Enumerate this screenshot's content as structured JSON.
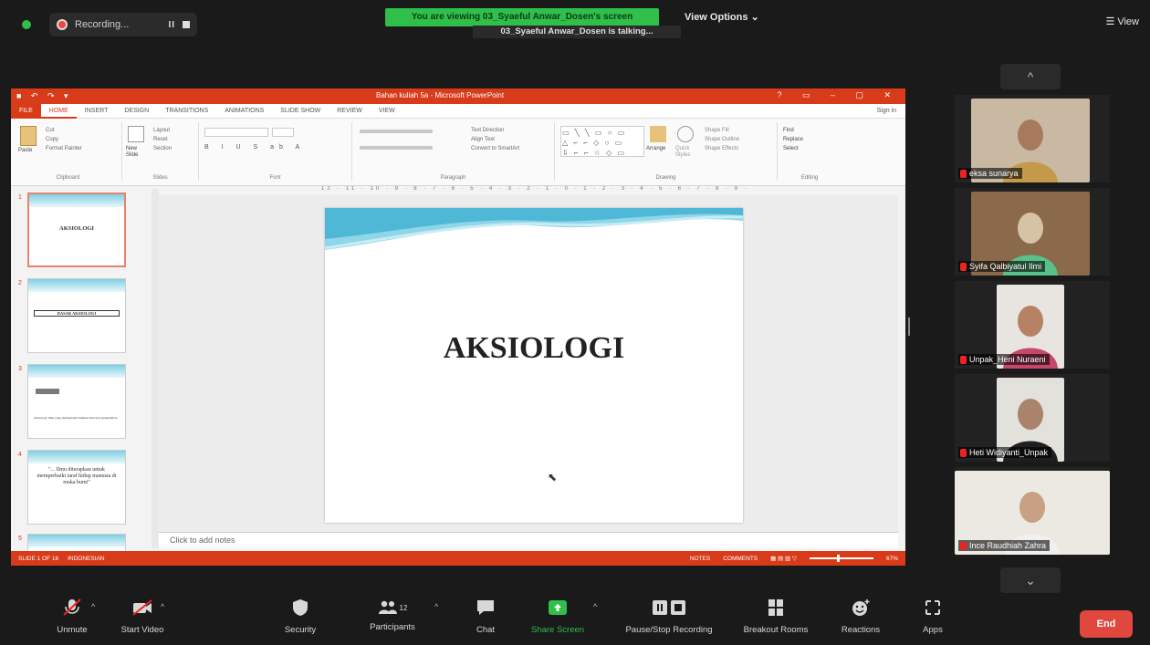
{
  "top_bar": {
    "recording_label": "Recording...",
    "viewing_banner": "You are viewing 03_Syaeful Anwar_Dosen's screen",
    "talking_label": "03_Syaeful Anwar_Dosen is talking...",
    "view_options_label": "View Options ⌄",
    "view_label": "☰ View"
  },
  "ppt": {
    "window_title": "Bahan kuliah 5a - Microsoft PowerPoint",
    "tabs": [
      "FILE",
      "HOME",
      "INSERT",
      "DESIGN",
      "TRANSITIONS",
      "ANIMATIONS",
      "SLIDE SHOW",
      "REVIEW",
      "VIEW"
    ],
    "sign_in": "Sign in",
    "ribbon_groups": [
      "Clipboard",
      "Slides",
      "Font",
      "Paragraph",
      "Drawing",
      "Editing"
    ],
    "ribbon_labels": {
      "paste": "Paste",
      "cut": "Cut",
      "copy": "Copy",
      "format_painter": "Format Painter",
      "new_slide": "New Slide",
      "layout": "Layout",
      "reset": "Reset",
      "section": "Section",
      "arrange": "Arrange",
      "quick_styles": "Quick Styles",
      "shape_fill": "Shape Fill",
      "shape_outline": "Shape Outline",
      "shape_effects": "Shape Effects",
      "find": "Find",
      "replace": "Replace",
      "select": "Select",
      "text_direction": "Text Direction",
      "align_text": "Align Text",
      "convert_smartart": "Convert to SmartArt"
    },
    "ruler_text": "12 · 11 · 10 · 9 · 8 · 7 · 6 · 5 · 4 · 3 · 2 · 1 · 0 · 1 · 2 · 3 · 4 · 5 · 6 · 7 · 8 · 9 · 10 · 11 · 12",
    "thumbnails": [
      {
        "num": "1",
        "text": "AKSIOLOGI"
      },
      {
        "num": "2",
        "text": "DASAR AKSIOLOGI"
      },
      {
        "num": "3",
        "text": "Aksiologi: Ilmu yang mempelajari hakikat nilai dari pengetahuan"
      },
      {
        "num": "4",
        "text": "\"... Ilmu diterapkan untuk memperbaiki taraf hidup manusia di muka bumi\""
      },
      {
        "num": "5",
        "text": ""
      }
    ],
    "slide_title": "AKSIOLOGI",
    "notes_placeholder": "Click to add notes",
    "status_left": [
      "SLIDE 1 OF 16",
      "INDONESIAN"
    ],
    "status_right": [
      "NOTES",
      "COMMENTS",
      "67%"
    ]
  },
  "participants": [
    {
      "name": "eksa sunarya",
      "bg": "#c9b9a3",
      "skin": "#a87a5c",
      "cloth": "#c49a4a"
    },
    {
      "name": "Syifa Qalbiyatul Ilmi",
      "bg": "#8a6a4a",
      "skin": "#d6c2a5",
      "cloth": "#59c08a"
    },
    {
      "name": "Unpak_Heni Nuraeni",
      "bg": "#e8e4df",
      "skin": "#b68266",
      "cloth": "#c7476b"
    },
    {
      "name": "Heti Widiyanti_Unpak",
      "bg": "#e3e1dc",
      "skin": "#a9836a",
      "cloth": "#1f1f1f"
    },
    {
      "name": "Ince Raudhiah Zahra",
      "bg": "#ece9e2",
      "skin": "#c8a084",
      "cloth": "#f0f0f0"
    }
  ],
  "toolbar": {
    "unmute": "Unmute",
    "start_video": "Start Video",
    "security": "Security",
    "participants": "Participants",
    "participants_count": "12",
    "chat": "Chat",
    "share_screen": "Share Screen",
    "pause_recording": "Pause/Stop Recording",
    "breakout_rooms": "Breakout Rooms",
    "reactions": "Reactions",
    "apps": "Apps",
    "end": "End"
  },
  "colors": {
    "ppt_accent": "#d83b1a",
    "zoom_green": "#2fbf4a",
    "end_red": "#e0473d"
  }
}
